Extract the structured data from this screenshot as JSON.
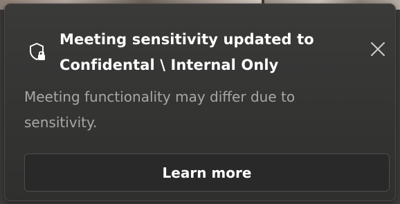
{
  "toast": {
    "title": "Meeting sensitivity updated to Confidental \\ Internal Only",
    "message": "Meeting functionality may differ due to sensitivity.",
    "action_label": "Learn more",
    "icon": "shield-lock-icon",
    "close_icon": "close-icon"
  }
}
